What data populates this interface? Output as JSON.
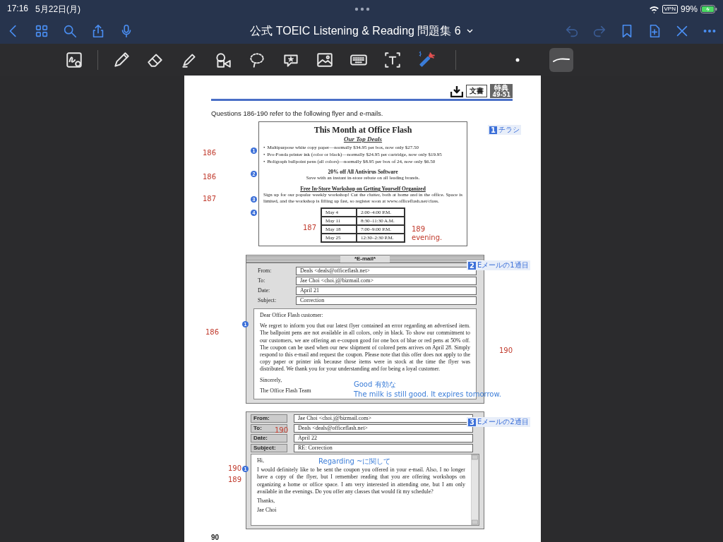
{
  "status_bar": {
    "time": "17:16",
    "date": "5月22日(月)",
    "vpn": "VPN",
    "battery": "99%"
  },
  "nav_bar": {
    "title": "公式 TOEIC Listening & Reading 問題集 6"
  },
  "toolbar": {
    "tools": [
      {
        "kind": "zoom",
        "selected": false
      },
      {
        "kind": "pen",
        "selected": false
      },
      {
        "kind": "eraser",
        "selected": false
      },
      {
        "kind": "highlighter",
        "selected": false
      },
      {
        "kind": "shapes",
        "selected": false
      },
      {
        "kind": "lasso",
        "selected": false
      },
      {
        "kind": "sticker",
        "selected": false
      },
      {
        "kind": "image",
        "selected": false
      },
      {
        "kind": "keyboard",
        "selected": false
      },
      {
        "kind": "text",
        "selected": false
      },
      {
        "kind": "laser",
        "selected": false
      }
    ],
    "options": [
      {
        "kind": "dot",
        "selected": false
      },
      {
        "kind": "stroke",
        "selected": true
      }
    ]
  },
  "page": {
    "header": {
      "badge_left": "文書",
      "badge_right_top": "特典",
      "badge_right_bottom": "49-51"
    },
    "intro": "Questions 186-190 refer to the following flyer and e-mails.",
    "section_tags": [
      {
        "number": "1",
        "label": "チラシ"
      },
      {
        "number": "2",
        "label": "Eメールの1通目"
      },
      {
        "number": "3",
        "label": "Eメールの2通目"
      }
    ],
    "flyer": {
      "title": "This Month at Office Flash",
      "subtitle": "Our Top Deals",
      "items": [
        {
          "bullet": "•",
          "text": "Multipurpose white copy paper—normally $34.95 per box, now only $27.50"
        },
        {
          "bullet": "•",
          "text": "Pro-Fonda printer ink (color or black)—normally $24.95 per cartridge, now only $19.95"
        },
        {
          "bullet": "•",
          "text": "Boligraph ballpoint pens (all colors)—normally $8.95 per box of 24, now only $6.50"
        }
      ],
      "antivirus_heading": "20% off All Antivirus Software",
      "antivirus_text": "Save with an instant in-store rebate on all leading brands.",
      "workshop_heading": "Free In-Store Workshop on Getting Yourself Organized",
      "workshop_text": "Sign up for our popular weekly workshop! Cut the clutter, both at home and in the office. Space is limited, and the workshop is filling up fast, so register soon at www.officeflash.net/class.",
      "schedule": [
        {
          "date": "May 4",
          "time": "2:00–4:00 P.M."
        },
        {
          "date": "May 11",
          "time": "8:30–11:30 A.M."
        },
        {
          "date": "May 18",
          "time": "7:00–9:00 P.M."
        },
        {
          "date": "May 25",
          "time": "12:30–2:30 P.M."
        }
      ]
    },
    "emails": [
      {
        "kind": "titled",
        "title": "*E-mail*",
        "fields": [
          {
            "label": "From:",
            "value": "Deals <deals@officeflash.net>"
          },
          {
            "label": "To:",
            "value": "Jae Choi <choi.j@bizmail.com>"
          },
          {
            "label": "Date:",
            "value": "April 21"
          },
          {
            "label": "Subject:",
            "value": "Correction"
          }
        ],
        "body": [
          "Dear Office Flash customer:",
          "We regret to inform you that our latest flyer contained an error regarding an advertised item. The ballpoint pens are not available in all colors, only in black. To show our commitment to our customers, we are offering an e-coupon good for one box of blue or red pens at 50% off. The coupon can be used when our new shipment of colored pens arrives on April 28. Simply respond to this e-mail and request the coupon. Please note that this offer does not apply to the copy paper or printer ink because those items were in stock at the time the flyer was distributed. We thank you for your understanding and for being a loyal customer.",
          "Sincerely,",
          "The Office Flash Team"
        ]
      },
      {
        "kind": "labeled",
        "fields": [
          {
            "label": "From:",
            "value": "Jae Choi <choi.j@bizmail.com>"
          },
          {
            "label": "To:",
            "value": "Deals <deals@officeflash.net>"
          },
          {
            "label": "Date:",
            "value": "April 22"
          },
          {
            "label": "Subject:",
            "value": "RE: Correction"
          }
        ],
        "body": [
          "Hi,",
          "I would definitely like to be sent the coupon you offered in your e-mail. Also, I no longer have a copy of the flyer, but I remember reading that you are offering workshops on organizing a home or office space. I am very interested in attending one, but I am only available in the evenings. Do you offer any classes that would fit my schedule?",
          "Thanks,",
          "Jae Choi"
        ]
      }
    ],
    "annotations": [
      {
        "kind": "marker",
        "text": "1",
        "color": "#3b6fd8"
      },
      {
        "kind": "marker",
        "text": "2",
        "color": "#3b6fd8"
      },
      {
        "kind": "marker",
        "text": "3",
        "color": "#3b6fd8"
      },
      {
        "kind": "marker",
        "text": "4",
        "color": "#3b6fd8"
      },
      {
        "kind": "note",
        "text": "186",
        "color": "#c0392b"
      },
      {
        "kind": "note",
        "text": "186",
        "color": "#c0392b"
      },
      {
        "kind": "note",
        "text": "187",
        "color": "#c0392b"
      },
      {
        "kind": "note",
        "text": "187",
        "color": "#c0392b"
      },
      {
        "kind": "note",
        "text": "189",
        "color": "#c0392b"
      },
      {
        "kind": "note",
        "text": "evening.",
        "color": "#c0392b"
      },
      {
        "kind": "marker",
        "text": "1",
        "color": "#3b6fd8"
      },
      {
        "kind": "note",
        "text": "186",
        "color": "#c0392b"
      },
      {
        "kind": "note",
        "text": "190",
        "color": "#c0392b"
      },
      {
        "kind": "note",
        "text": "Good 有効な",
        "color": "#3b7dd8"
      },
      {
        "kind": "note",
        "text": "The milk is still good. It expires tomorrow.",
        "color": "#3b7dd8"
      },
      {
        "kind": "note",
        "text": "190",
        "color": "#c0392b"
      },
      {
        "kind": "note",
        "text": "Regarding ~に関して",
        "color": "#3b7dd8"
      },
      {
        "kind": "note",
        "text": "190",
        "color": "#c0392b"
      },
      {
        "kind": "marker",
        "text": "1",
        "color": "#3b6fd8"
      },
      {
        "kind": "note",
        "text": "189",
        "color": "#c0392b"
      }
    ],
    "page_number": "90"
  }
}
